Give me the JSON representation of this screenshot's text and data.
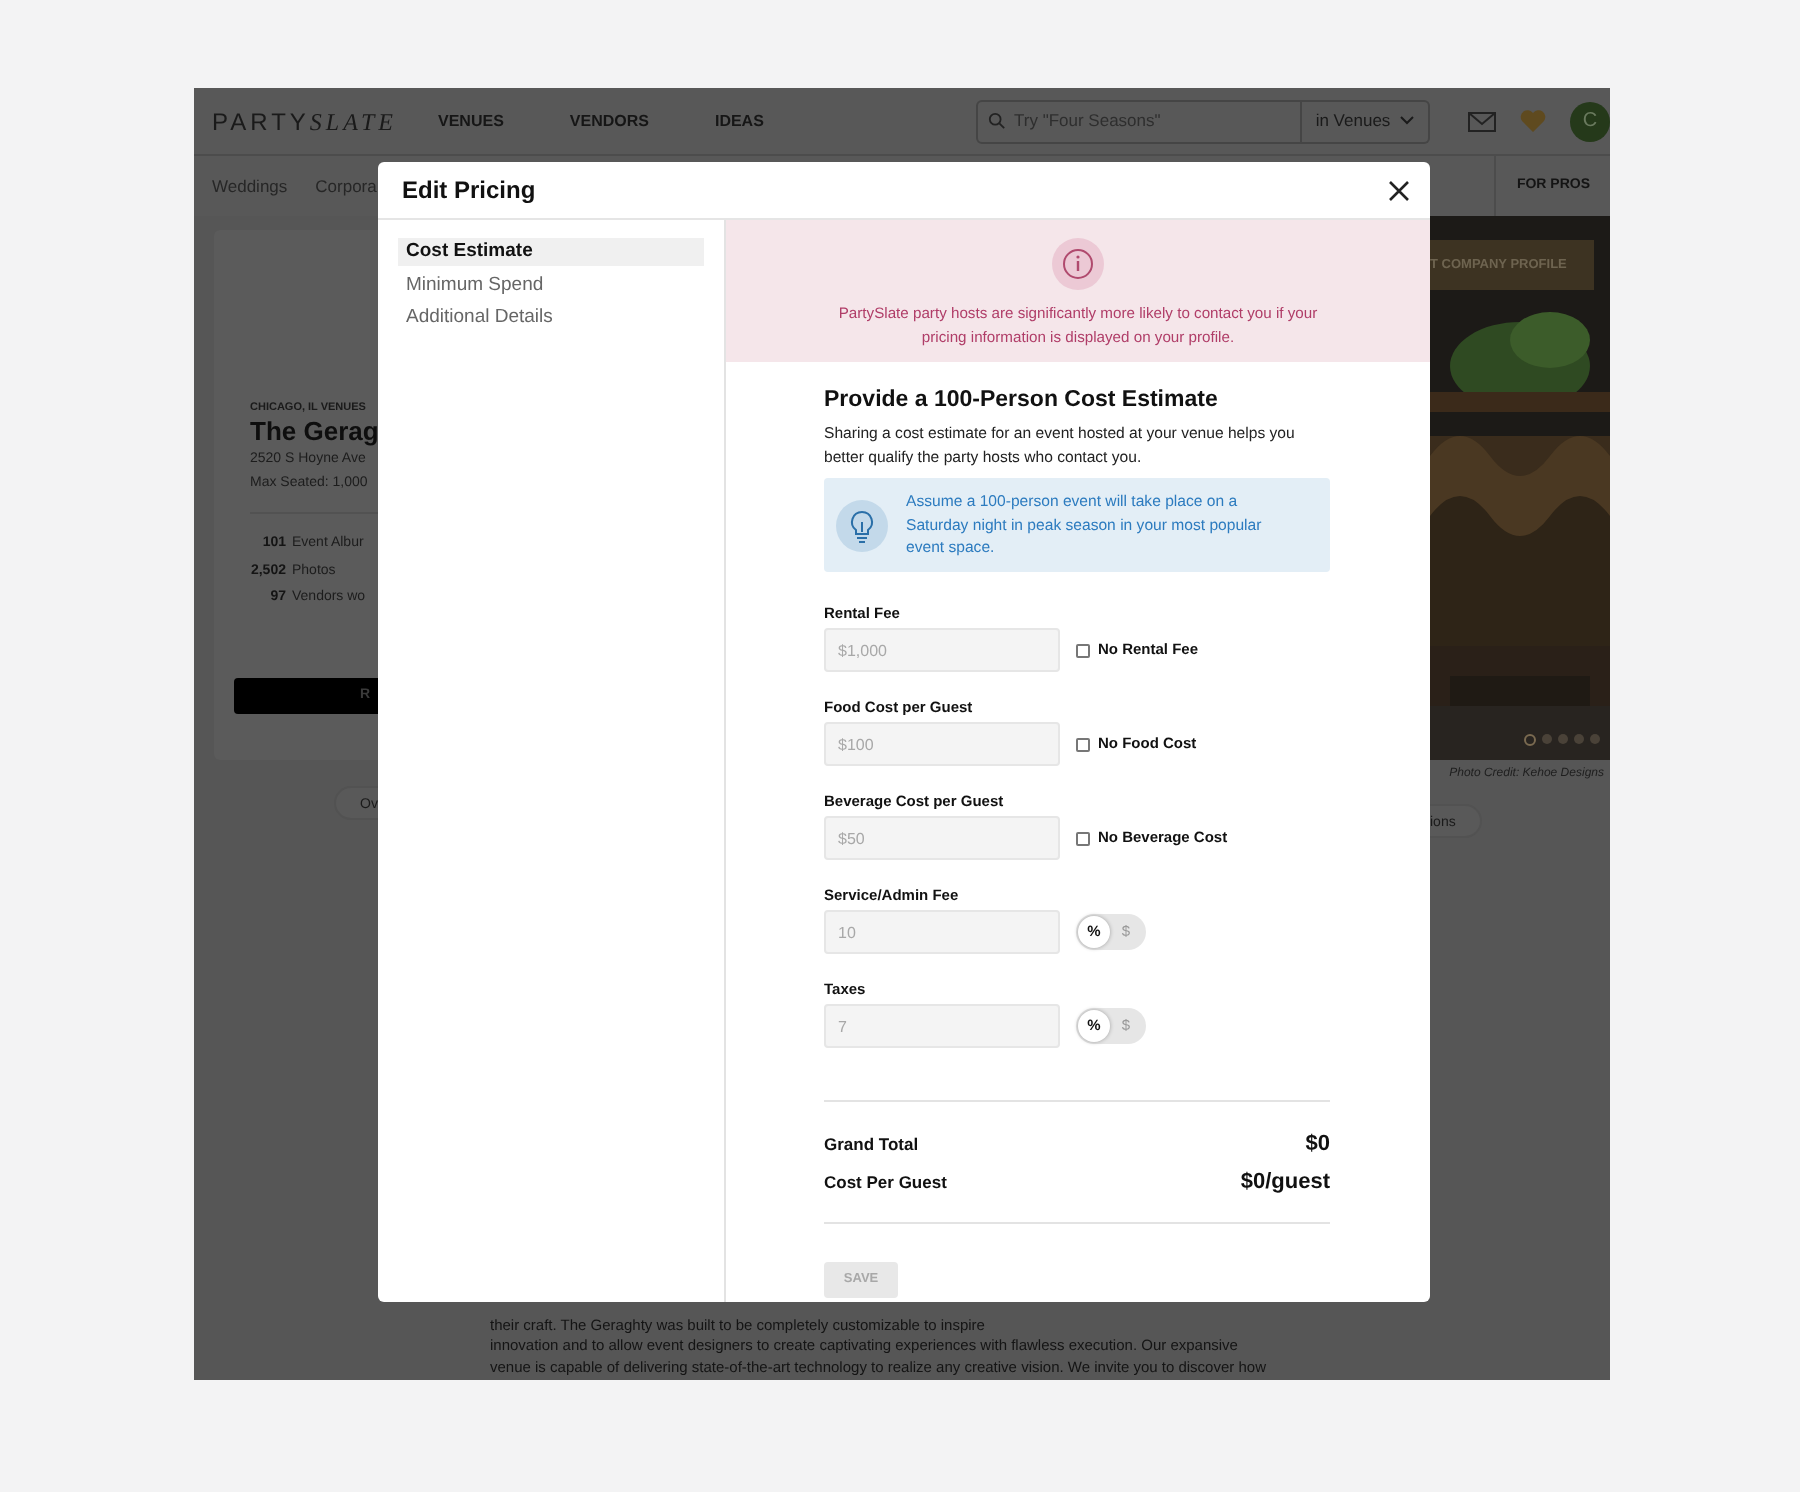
{
  "background_page": {
    "nav": {
      "logo_a": "PARTY",
      "logo_b": "SLATE",
      "links": [
        "VENUES",
        "VENDORS",
        "IDEAS"
      ],
      "search_placeholder": "Try \"Four Seasons\"",
      "scope": "in Venues",
      "avatar": "C"
    },
    "subnav": {
      "links": [
        "Weddings",
        "Corpora"
      ],
      "pros": "FOR PROS"
    },
    "venue_card": {
      "city": "CHICAGO, IL VENUES",
      "name": "The Gerag",
      "address": "2520 S Hoyne Ave",
      "capacity": "Max Seated: 1,000",
      "stats": [
        {
          "value": "101",
          "label": "Event Albur"
        },
        {
          "value": "2,502",
          "label": "Photos"
        },
        {
          "value": "97",
          "label": "Vendors wo"
        }
      ],
      "button": "R"
    },
    "tab_left": "Ov",
    "tab_right": "ions",
    "photo": {
      "button": "T COMPANY PROFILE",
      "credit": "Photo Credit: Kehoe Designs",
      "dots": [
        {
          "selected": true
        },
        {
          "selected": false
        },
        {
          "selected": false
        },
        {
          "selected": false
        },
        {
          "selected": false
        }
      ]
    },
    "description_lines": [
      "their craft. The Geraghty was built to be completely customizable to inspire",
      "innovation and to allow event designers to create captivating experiences with flawless execution. Our expansive",
      "venue is capable of delivering state-of-the-art technology to realize any creative vision. We invite you to discover how"
    ]
  },
  "modal": {
    "title": "Edit Pricing",
    "sidebar": [
      {
        "label": "Cost Estimate",
        "selected": true
      },
      {
        "label": "Minimum Spend",
        "selected": false
      },
      {
        "label": "Additional Details",
        "selected": false
      }
    ],
    "banner": "PartySlate party hosts are significantly more likely to contact you if your pricing information is displayed on your profile.",
    "heading": "Provide a 100-Person Cost Estimate",
    "description": "Sharing a cost estimate for an event hosted at your venue helps you better qualify the party hosts who contact you.",
    "tip": "Assume a 100-person event will take place on a Saturday night in peak season in your most popular event space.",
    "fields": [
      {
        "label": "Rental Fee",
        "placeholder": "$1,000",
        "kind": "checkbox",
        "option": {
          "label": "No Rental Fee",
          "checked": false
        }
      },
      {
        "label": "Food Cost per Guest",
        "placeholder": "$100",
        "kind": "checkbox",
        "option": {
          "label": "No Food Cost",
          "checked": false
        }
      },
      {
        "label": "Beverage Cost per Guest",
        "placeholder": "$50",
        "kind": "checkbox",
        "option": {
          "label": "No Beverage Cost",
          "checked": false
        }
      },
      {
        "label": "Service/Admin Fee",
        "placeholder": "10",
        "kind": "unit",
        "units": [
          {
            "label": "%",
            "selected": true
          },
          {
            "label": "$",
            "selected": false
          }
        ]
      },
      {
        "label": "Taxes",
        "placeholder": "7",
        "kind": "unit",
        "units": [
          {
            "label": "%",
            "selected": true
          },
          {
            "label": "$",
            "selected": false
          }
        ]
      }
    ],
    "totals": [
      {
        "label": "Grand Total",
        "value": "$0"
      },
      {
        "label": "Cost Per Guest",
        "value": "$0/guest"
      }
    ],
    "save": {
      "label": "SAVE",
      "disabled": true
    }
  }
}
